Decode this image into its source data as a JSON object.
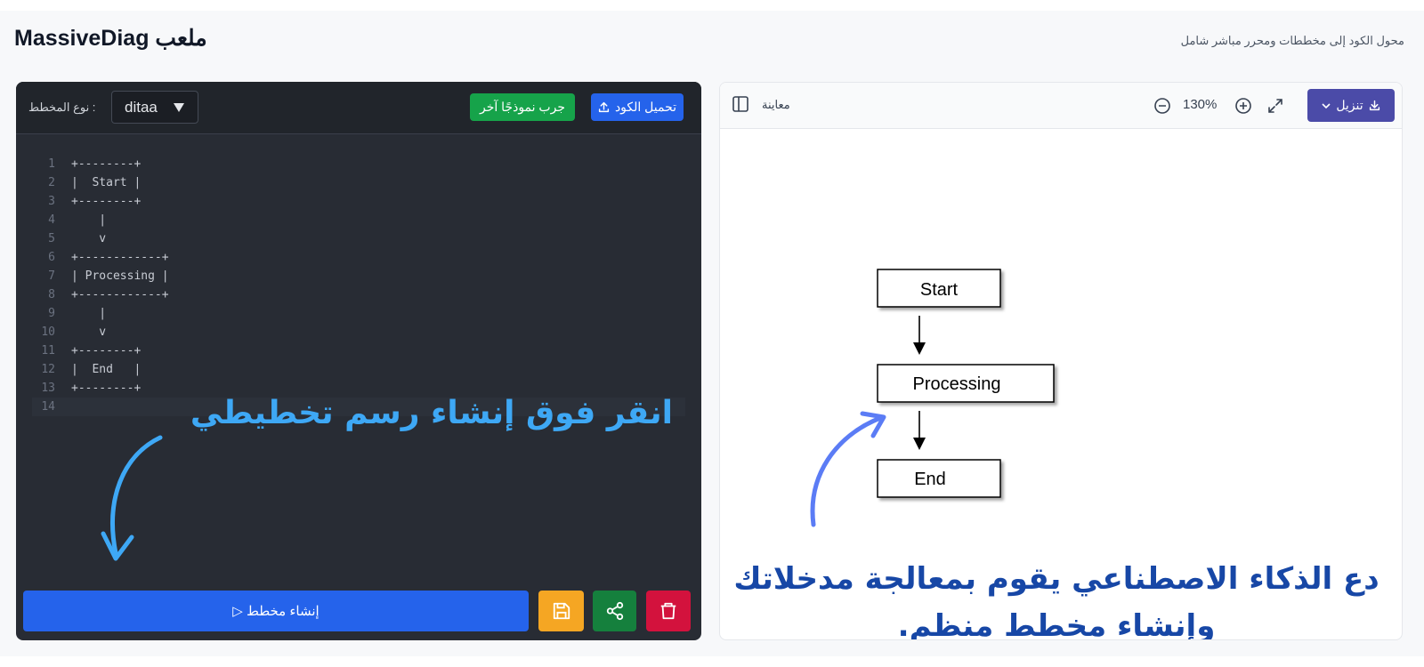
{
  "header": {
    "title": "MassiveDiag ملعب",
    "tagline": "محول الكود إلى مخططات ومحرر مباشر شامل"
  },
  "editor": {
    "upload_label": "تحميل الكود",
    "sample_label": "جرب نموذجًا آخر",
    "diagram_type_label": ": نوع المخطط",
    "diagram_type_value": "ditaa",
    "code_lines": [
      {
        "n": "1",
        "text": "+--------+"
      },
      {
        "n": "2",
        "text": "|  Start |"
      },
      {
        "n": "3",
        "text": "+--------+"
      },
      {
        "n": "4",
        "text": "    |"
      },
      {
        "n": "5",
        "text": "    v"
      },
      {
        "n": "6",
        "text": "+------------+"
      },
      {
        "n": "7",
        "text": "| Processing |"
      },
      {
        "n": "8",
        "text": "+------------+"
      },
      {
        "n": "9",
        "text": "    |"
      },
      {
        "n": "10",
        "text": "    v"
      },
      {
        "n": "11",
        "text": "+--------+"
      },
      {
        "n": "12",
        "text": "|  End   |"
      },
      {
        "n": "13",
        "text": "+--------+"
      },
      {
        "n": "14",
        "text": ""
      }
    ],
    "create_label": "▷ إنشاء مخطط",
    "annotation": "انقر فوق إنشاء رسم تخطيطي"
  },
  "preview": {
    "label": "معاينة",
    "zoom_level": "130%",
    "download_label": "تنزيل",
    "boxes": {
      "start": "Start",
      "processing": "Processing",
      "end": "End"
    },
    "annotation_line1": "دع الذكاء الاصطناعي يقوم بمعالجة مدخلاتك",
    "annotation_line2": "وإنشاء مخطط منظم."
  },
  "colors": {
    "primary": "#2563eb",
    "success": "#16a34a",
    "warning": "#f5a623",
    "danger": "#d3123d",
    "annotation_light": "#3ea8f5",
    "annotation_dark": "#1747a6"
  }
}
